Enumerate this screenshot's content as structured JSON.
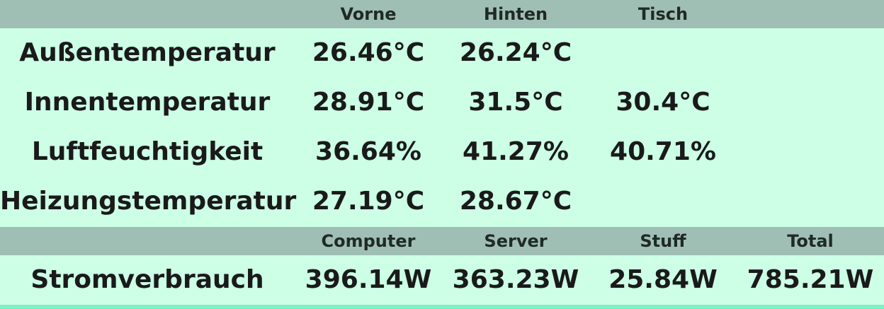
{
  "climate": {
    "headers": [
      "Vorne",
      "Hinten",
      "Tisch"
    ],
    "rows": [
      {
        "label": "Außentemperatur",
        "values": [
          "26.46°C",
          "26.24°C",
          ""
        ]
      },
      {
        "label": "Innentemperatur",
        "values": [
          "28.91°C",
          "31.5°C",
          "30.4°C"
        ]
      },
      {
        "label": "Luftfeuchtigkeit",
        "values": [
          "36.64%",
          "41.27%",
          "40.71%"
        ]
      },
      {
        "label": "Heizungstemperatur",
        "values": [
          "27.19°C",
          "28.67°C",
          ""
        ]
      }
    ]
  },
  "power": {
    "headers": [
      "Computer",
      "Server",
      "Stuff",
      "Total"
    ],
    "label": "Stromverbrauch",
    "values": [
      "396.14W",
      "363.23W",
      "25.84W",
      "785.21W"
    ]
  },
  "colors": {
    "background": "#ccffe6",
    "header_band": "#a0bfb4",
    "bottom_accent": "#7ff0c4"
  }
}
